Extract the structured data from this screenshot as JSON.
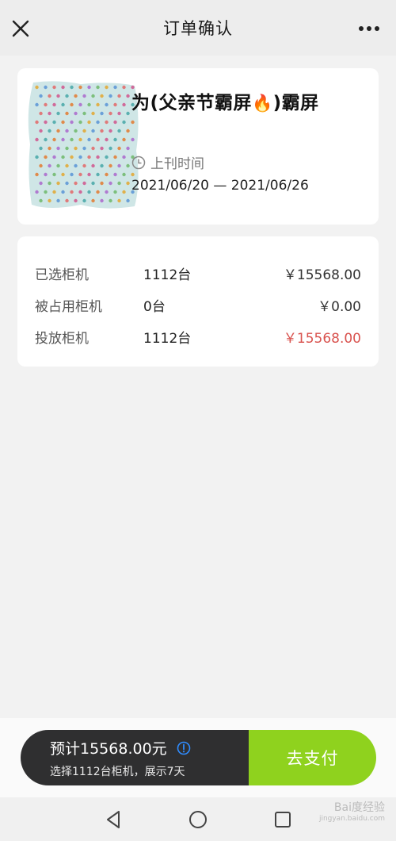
{
  "header": {
    "title": "订单确认"
  },
  "product": {
    "title_prefix": "为(父亲节霸屏",
    "title_emoji": "🔥",
    "title_suffix": ")霸屏",
    "date_label": "上刊时间",
    "date_range": "2021/06/20 — 2021/06/26"
  },
  "summary": {
    "rows": [
      {
        "label": "已选柜机",
        "qty": "1112台",
        "price": "￥15568.00"
      },
      {
        "label": "被占用柜机",
        "qty": "0台",
        "price": "￥0.00"
      },
      {
        "label": "投放柜机",
        "qty": "1112台",
        "price": "￥15568.00"
      }
    ]
  },
  "footer": {
    "estimate": "预计15568.00元",
    "subtitle": "选择1112台柜机，展示7天",
    "pay_label": "去支付"
  },
  "watermark": {
    "text": "Bai度经验",
    "sub": "jingyan.baidu.com"
  },
  "colors": {
    "accent_green": "#8fd21e",
    "price_red": "#d9534f",
    "info_blue": "#2f8cff"
  }
}
